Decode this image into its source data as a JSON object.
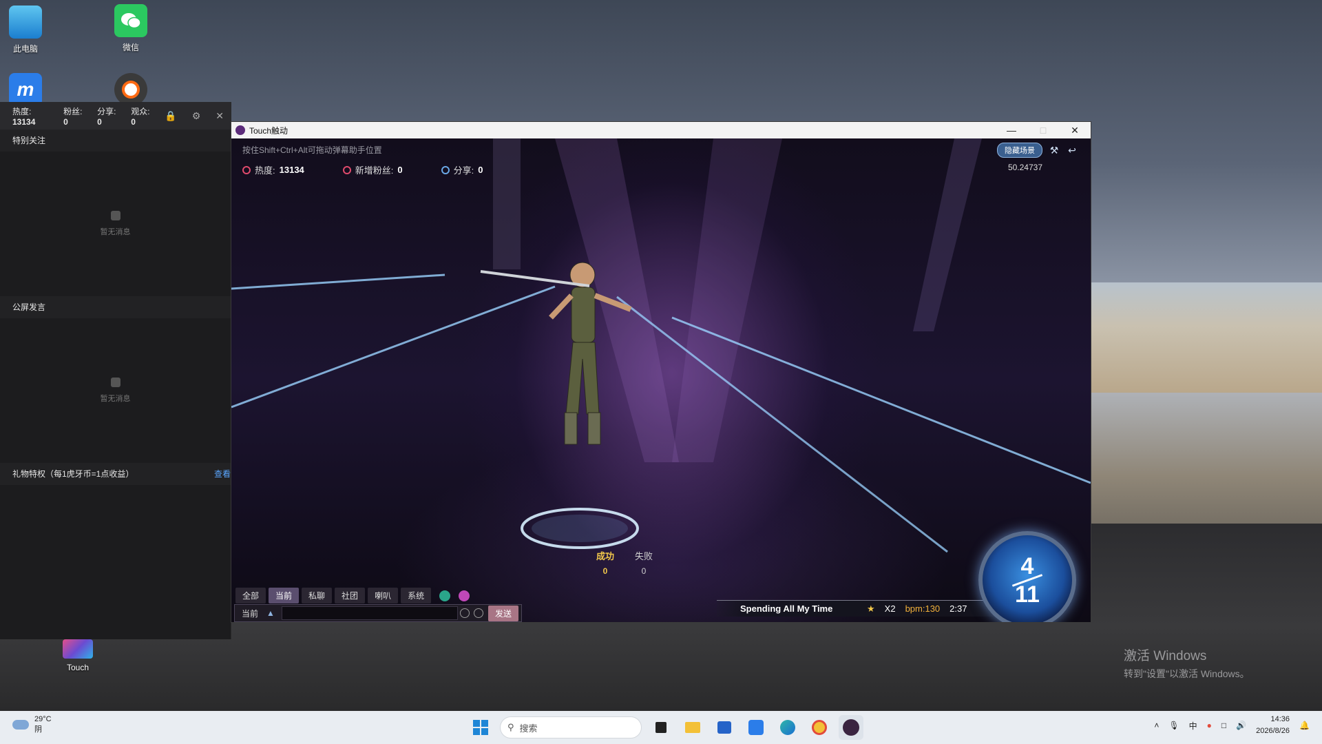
{
  "desktop": {
    "icons": [
      {
        "label": "此电脑"
      },
      {
        "label": "微信"
      },
      {
        "label": ""
      },
      {
        "label": ""
      },
      {
        "label": "Touch"
      }
    ]
  },
  "assistant": {
    "stats": {
      "heat_label": "热度:",
      "heat": "13134",
      "fans_label": "粉丝:",
      "fans": "0",
      "share_label": "分享:",
      "share": "0",
      "viewers_label": "观众:",
      "viewers": "0"
    },
    "sections": {
      "special_follow": "特别关注",
      "empty1": "暂无消息",
      "public_chat": "公屏发言",
      "empty2": "暂无消息",
      "gift_rights": "礼物特权（每1虎牙币=1点收益）",
      "view_more": "查看"
    }
  },
  "game_window": {
    "title": "Touch触动",
    "hint": "按住Shift+Ctrl+Alt可拖动弹幕助手位置",
    "stats": {
      "heat_label": "热度:",
      "heat": "13134",
      "new_fans_label": "新增粉丝:",
      "new_fans": "0",
      "share_label": "分享:",
      "share": "0"
    },
    "hide_scene_label": "隐藏场景",
    "timer_value": "50.24737",
    "judge": {
      "success_label": "成功",
      "success": "0",
      "fail_label": "失败",
      "fail": "0"
    },
    "chat_tabs": [
      "全部",
      "当前",
      "私聊",
      "社团",
      "喇叭",
      "系统"
    ],
    "chat_channel": "当前",
    "chat_placeholder": "",
    "send_label": "发送",
    "song": {
      "title": "Spending All My Time",
      "multiplier": "X2",
      "bpm": "bpm:130",
      "time": "2:37"
    },
    "combo": {
      "top": "4",
      "bottom": "11"
    }
  },
  "watermark": {
    "line1": "激活 Windows",
    "line2": "转到\"设置\"以激活 Windows。"
  },
  "taskbar": {
    "weather_temp": "29°C",
    "weather_desc": "阴",
    "search_placeholder": "搜索",
    "time": "14:36",
    "date": "2026/8/26"
  },
  "colors": {
    "accent_gold": "#f2c84b",
    "taskbar_bg": "#e9edf2",
    "assistant_bg": "#1c1c1e"
  }
}
